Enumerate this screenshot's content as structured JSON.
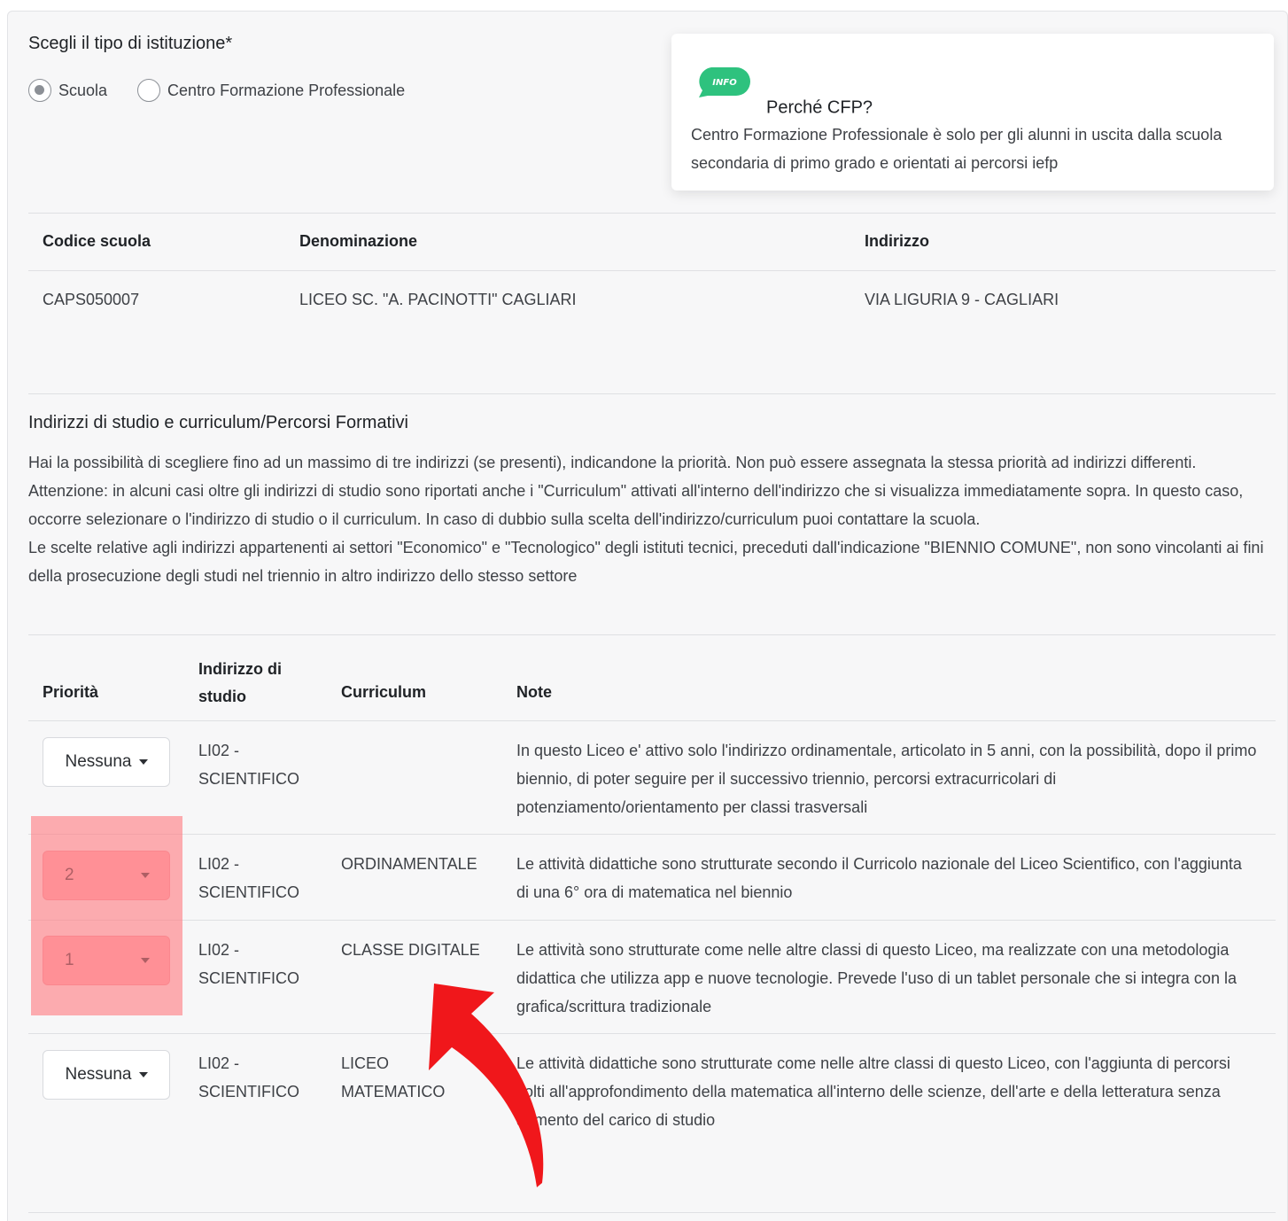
{
  "institution": {
    "title": "Scegli il tipo di istituzione*",
    "options": [
      {
        "label": "Scuola",
        "checked": true
      },
      {
        "label": "Centro Formazione Professionale",
        "checked": false
      }
    ]
  },
  "info_card": {
    "badge": "INFO",
    "title": "Perché CFP?",
    "text": "Centro Formazione Professionale è solo per gli alunni in uscita dalla scuola secondaria di primo grado e orientati ai percorsi iefp",
    "badge_color": "#2ec27e"
  },
  "school_table": {
    "headers": [
      "Codice scuola",
      "Denominazione",
      "Indirizzo"
    ],
    "row": [
      "CAPS050007",
      "LICEO SC. \"A. PACINOTTI\" CAGLIARI",
      "VIA LIGURIA 9 - CAGLIARI"
    ]
  },
  "study_section": {
    "title": "Indirizzi di studio e curriculum/Percorsi Formativi",
    "paragraphs": [
      "Hai la possibilità di scegliere fino ad un massimo di tre indirizzi (se presenti), indicandone la priorità. Non può essere assegnata la stessa priorità ad indirizzi differenti.",
      "Attenzione: in alcuni casi oltre gli indirizzi di studio sono riportati anche i \"Curriculum\" attivati all'interno dell'indirizzo che si visualizza immediatamente sopra. In questo caso, occorre selezionare o l'indirizzo di studio o il curriculum. In caso di dubbio sulla scelta dell'indirizzo/curriculum puoi contattare la scuola.",
      "Le scelte relative agli indirizzi appartenenti ai settori \"Economico\" e \"Tecnologico\" degli istituti tecnici, preceduti dall'indicazione \"BIENNIO COMUNE\", non sono vincolanti ai fini della prosecuzione degli studi nel triennio in altro indirizzo dello stesso settore"
    ]
  },
  "priority_table": {
    "headers": {
      "priority": "Priorità",
      "address_line1": "Indirizzo di",
      "address_line2": "studio",
      "curriculum": "Curriculum",
      "notes": "Note"
    },
    "rows": [
      {
        "priority": "Nessuna",
        "address1": "LI02 -",
        "address2": "SCIENTIFICO",
        "curriculum": "",
        "note": "In questo Liceo e' attivo solo l'indirizzo ordinamentale, articolato in 5 anni, con la possibilità, dopo il primo biennio, di poter seguire per il successivo triennio, percorsi extracurricolari di potenziamento/orientamento per classi trasversali"
      },
      {
        "priority": "2",
        "address1": "LI02 -",
        "address2": "SCIENTIFICO",
        "curriculum": "ORDINAMENTALE",
        "note": "Le attività didattiche sono strutturate secondo il Curricolo nazionale del Liceo Scientifico, con l'aggiunta di una 6° ora di matematica nel biennio"
      },
      {
        "priority": "1",
        "address1": "LI02 -",
        "address2": "SCIENTIFICO",
        "curriculum": "CLASSE DIGITALE",
        "note": "Le attività sono strutturate come nelle altre classi di questo Liceo, ma realizzate con una metodologia didattica che utilizza app e nuove tecnologie. Prevede l'uso di un tablet personale che si integra con la grafica/scrittura tradizionale"
      },
      {
        "priority": "Nessuna",
        "address1": "LI02 -",
        "address2": "SCIENTIFICO",
        "curriculum1": "LICEO",
        "curriculum2": "MATEMATICO",
        "note": "Le attività didattiche sono strutturate come nelle altre classi di questo Liceo, con l'aggiunta di percorsi volti all'approfondimento della matematica all'interno delle scienze, dell'arte e della letteratura senza aumento del carico di studio"
      }
    ]
  },
  "annotation": {
    "highlight_color": "#ff7d82",
    "arrow_color": "#f0171b"
  }
}
